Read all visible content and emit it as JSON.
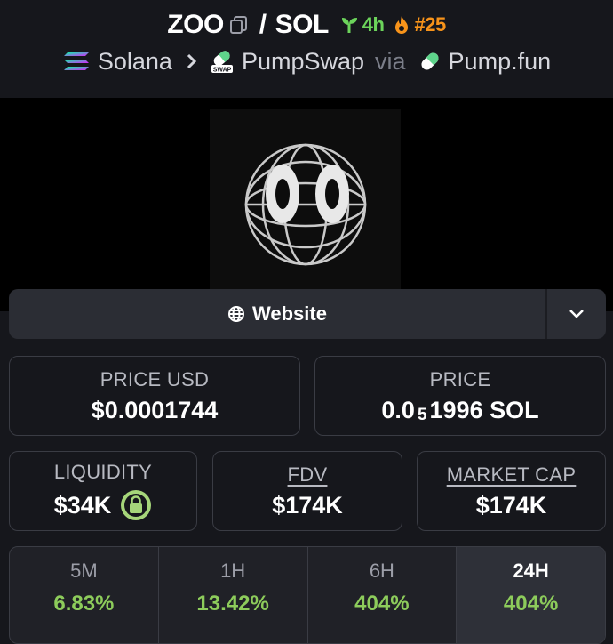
{
  "pair": {
    "base": "ZOO",
    "separator": "/",
    "quote": "SOL",
    "age": "4h",
    "rank": "#25"
  },
  "chain": {
    "network": "Solana",
    "dex": "PumpSwap",
    "via": "via",
    "launchpad": "Pump.fun"
  },
  "website": {
    "label": "Website"
  },
  "price_usd": {
    "label": "PRICE USD",
    "value": "$0.0001744"
  },
  "price": {
    "label": "PRICE",
    "prefix": "0.0",
    "zeros": "5",
    "digits": "1996 SOL"
  },
  "liquidity": {
    "label": "LIQUIDITY",
    "value": "$34K"
  },
  "fdv": {
    "label": "FDV",
    "value": "$174K"
  },
  "market_cap": {
    "label": "MARKET CAP",
    "value": "$174K"
  },
  "changes": [
    {
      "label": "5M",
      "value": "6.83%"
    },
    {
      "label": "1H",
      "value": "13.42%"
    },
    {
      "label": "6H",
      "value": "404%"
    },
    {
      "label": "24H",
      "value": "404%"
    }
  ],
  "colors": {
    "positive": "#8dcc5b",
    "age": "#6cd45b",
    "rank": "#f7931a"
  }
}
